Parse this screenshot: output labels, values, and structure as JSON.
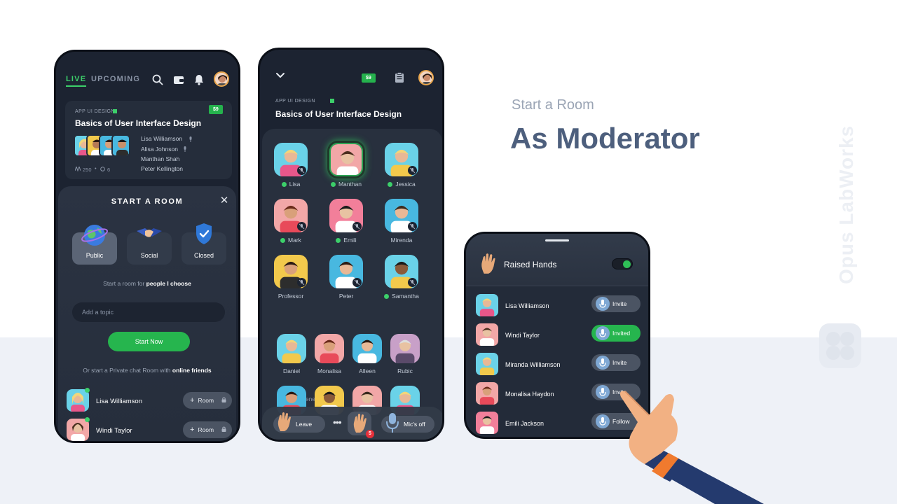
{
  "heading": {
    "subtitle": "Start a Room",
    "title": "As Moderator"
  },
  "brand": {
    "name": "Opus LabWorks"
  },
  "colors": {
    "accent_green": "#26b54e",
    "dark_bg": "#1c2331",
    "heading_blue": "#4d5f7d"
  },
  "phone1": {
    "tabs": {
      "live": "LIVE",
      "upcoming": "UPCOMING"
    },
    "icons": [
      "search-icon",
      "wallet-icon",
      "bell-icon"
    ],
    "card": {
      "tag": "APP UI DESIGN",
      "title": "Basics of User Interface Design",
      "price": "$9",
      "speakers": [
        "Lisa Williamson",
        "Alisa Johnson",
        "Manthan Shah",
        "Peter Kellington"
      ],
      "listeners": "250",
      "speakers_count": "6"
    },
    "sheet": {
      "title": "START A ROOM",
      "types": [
        {
          "label": "Public",
          "icon": "globe-icon",
          "selected": true
        },
        {
          "label": "Social",
          "icon": "handshake-icon",
          "selected": false
        },
        {
          "label": "Closed",
          "icon": "shield-icon",
          "selected": false
        }
      ],
      "hint_prefix": "Start a room for ",
      "hint_bold": "people I choose",
      "topic_placeholder": "Add a topic",
      "start_label": "Start Now",
      "private_prefix": "Or start a Private chat Room with ",
      "private_bold": "online friends",
      "friends": [
        {
          "name": "Lisa Williamson",
          "button": "Room"
        },
        {
          "name": "Windi Taylor",
          "button": "Room"
        }
      ]
    }
  },
  "phone2": {
    "price": "$9",
    "tag": "APP UI DESIGN",
    "title": "Basics of User Interface Design",
    "speakers": [
      {
        "name": "Lisa",
        "moderator": true
      },
      {
        "name": "Manthan",
        "moderator": true
      },
      {
        "name": "Jessica",
        "moderator": true
      },
      {
        "name": "Mark",
        "moderator": true
      },
      {
        "name": "Emili",
        "moderator": true
      },
      {
        "name": "Mirenda",
        "moderator": false
      },
      {
        "name": "Professor",
        "moderator": false
      },
      {
        "name": "Peter",
        "moderator": false
      },
      {
        "name": "Samantha",
        "moderator": true
      }
    ],
    "listeners_label": "Other Listeners",
    "listeners": [
      "Daniel",
      "Monalisa",
      "Alleen",
      "Rubic"
    ],
    "bar": {
      "leave": "Leave",
      "hand_count": "5",
      "mic": "Mic's off"
    }
  },
  "phone3": {
    "title": "Raised Hands",
    "toggle_on": true,
    "rows": [
      {
        "name": "Lisa Williamson",
        "action": "Invite"
      },
      {
        "name": "Windi Taylor",
        "action": "Invited"
      },
      {
        "name": "Miranda Williamson",
        "action": "Invite"
      },
      {
        "name": "Monalisa Haydon",
        "action": "Invite"
      },
      {
        "name": "Emili Jackson",
        "action": "Follow"
      }
    ]
  }
}
